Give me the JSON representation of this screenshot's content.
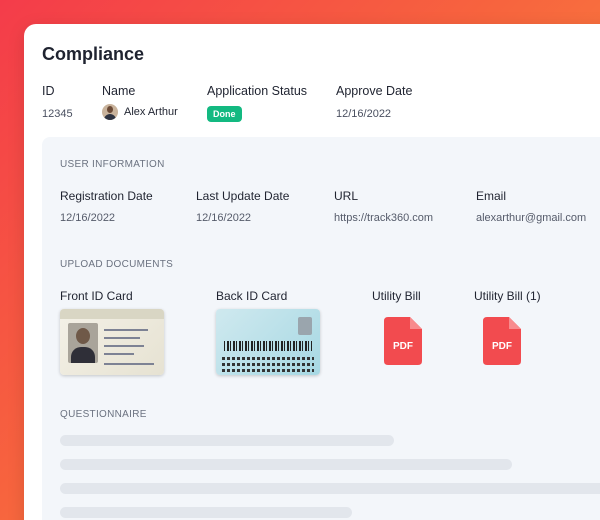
{
  "page": {
    "title": "Compliance"
  },
  "header": {
    "columns": [
      {
        "label": "ID",
        "value": "12345"
      },
      {
        "label": "Name",
        "value": "Alex Arthur"
      },
      {
        "label": "Application Status",
        "value": "Done"
      },
      {
        "label": "Approve Date",
        "value": "12/16/2022"
      }
    ]
  },
  "user_info": {
    "section_title": "USER INFORMATION",
    "fields": [
      {
        "label": "Registration Date",
        "value": "12/16/2022"
      },
      {
        "label": "Last Update Date",
        "value": "12/16/2022"
      },
      {
        "label": "URL",
        "value": "https://track360.com"
      },
      {
        "label": "Email",
        "value": "alexarthur@gmail.com"
      }
    ]
  },
  "documents": {
    "section_title": "UPLOAD DOCUMENTS",
    "items": [
      {
        "label": "Front ID Card",
        "kind": "id-front"
      },
      {
        "label": "Back ID Card",
        "kind": "id-back"
      },
      {
        "label": "Utility Bill",
        "kind": "pdf",
        "badge": "PDF"
      },
      {
        "label": "Utility Bill (1)",
        "kind": "pdf",
        "badge": "PDF"
      }
    ]
  },
  "questionnaire": {
    "section_title": "QUESTIONNAIRE"
  },
  "colors": {
    "status_done": "#13b981",
    "pdf_red": "#f24b4f",
    "accent_gradient_start": "#f43c4a",
    "accent_gradient_end": "#fb9a3c"
  }
}
